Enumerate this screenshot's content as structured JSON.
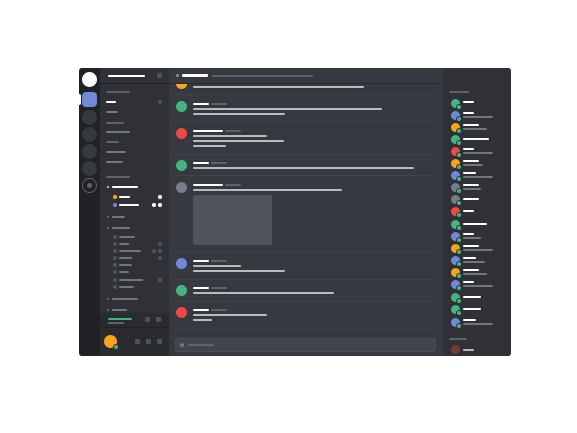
{
  "app": {
    "colors": {
      "blurple": "#7289da",
      "green": "#43b581",
      "red": "#f04747",
      "yellow": "#faa61a",
      "grey": "#747f8d"
    },
    "icons": {
      "home": "home-icon",
      "add_server": "add-server-icon",
      "settings": "gear-icon",
      "mute": "microphone-icon",
      "deafen": "headphones-icon",
      "disconnect": "phone-icon"
    },
    "note": ""
  }
}
